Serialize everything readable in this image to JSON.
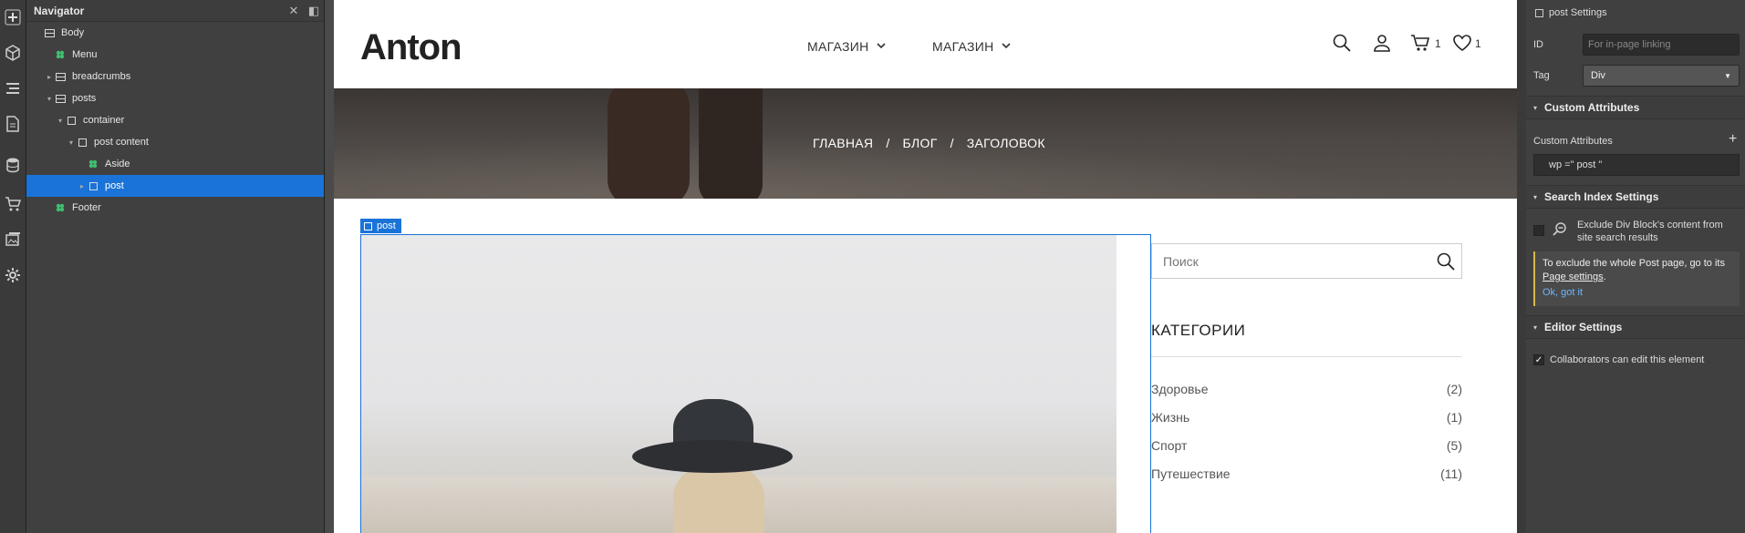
{
  "rail": {
    "icons": [
      "add-icon",
      "box-icon",
      "layers-icon",
      "pages-icon",
      "database-icon",
      "cart-icon",
      "assets-icon",
      "settings-icon"
    ]
  },
  "navigator": {
    "title": "Navigator",
    "close_glyph": "✕",
    "dock_glyph": "◧",
    "nodes": [
      {
        "label": "Body",
        "icon": "body",
        "depth": 0,
        "arrow": ""
      },
      {
        "label": "Menu",
        "icon": "symbol",
        "depth": 1,
        "arrow": ""
      },
      {
        "label": "breadcrumbs",
        "icon": "section",
        "depth": 1,
        "arrow": "▸"
      },
      {
        "label": "posts",
        "icon": "section",
        "depth": 1,
        "arrow": "▾"
      },
      {
        "label": "container",
        "icon": "div",
        "depth": 2,
        "arrow": "▾"
      },
      {
        "label": "post content",
        "icon": "div",
        "depth": 3,
        "arrow": "▾"
      },
      {
        "label": "Aside",
        "icon": "symbol",
        "depth": 4,
        "arrow": ""
      },
      {
        "label": "post",
        "icon": "div",
        "depth": 4,
        "arrow": "▸",
        "selected": true
      },
      {
        "label": "Footer",
        "icon": "symbol",
        "depth": 1,
        "arrow": ""
      }
    ]
  },
  "site": {
    "logo": "Anton",
    "menu": [
      {
        "label": "МАГАЗИН",
        "chevron": "⌄"
      },
      {
        "label": "МАГАЗИН",
        "chevron": "⌄"
      }
    ],
    "cart_count": "1",
    "wishlist_count": "1",
    "breadcrumbs": [
      "ГЛАВНАЯ",
      "/",
      "БЛОГ",
      "/",
      "ЗАГОЛОВОК"
    ],
    "post_tag": "post",
    "search_placeholder": "Поиск",
    "categories_title": "КАТЕГОРИИ",
    "categories": [
      {
        "name": "Здоровье",
        "count": "(2)"
      },
      {
        "name": "Жизнь",
        "count": "(1)"
      },
      {
        "name": "Спорт",
        "count": "(5)"
      },
      {
        "name": "Путешествие",
        "count": "(11)"
      }
    ]
  },
  "settings": {
    "header": "post Settings",
    "id_label": "ID",
    "id_placeholder": "For in-page linking",
    "tag_label": "Tag",
    "tag_value": "Div",
    "custom_attrs_section": "Custom Attributes",
    "custom_attrs_label": "Custom Attributes",
    "add_glyph": "+",
    "attr_value": "wp =\" post \"",
    "search_index_section": "Search Index Settings",
    "exclude_text": "Exclude Div Block's content from site search results",
    "notice_text": "To exclude the whole Post page, go to its",
    "notice_link_text": "Page settings",
    "notice_period": ".",
    "notice_ok": "Ok, got it",
    "editor_section": "Editor Settings",
    "collab_text": "Collaborators can edit this element",
    "check_glyph": "✓",
    "section_arrow": "▾"
  },
  "colors": {
    "selection": "#1a73d9",
    "panel": "#404040",
    "symbol": "#3fbf6f"
  }
}
